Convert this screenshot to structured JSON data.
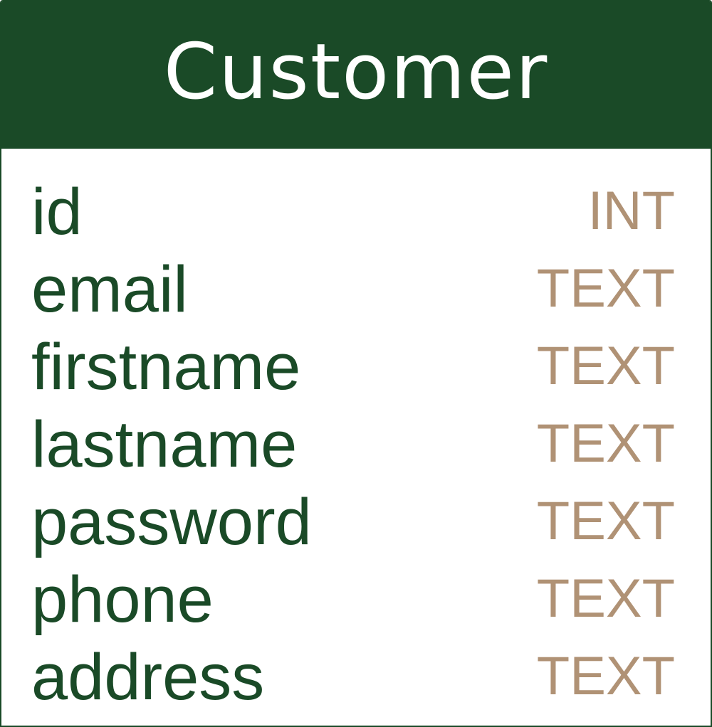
{
  "entity": {
    "title": "Customer",
    "header_color": "#1a4a27",
    "name_color": "#1a4a27",
    "type_color": "#b09275",
    "fields": [
      {
        "name": "id",
        "type": "INT"
      },
      {
        "name": "email",
        "type": "TEXT"
      },
      {
        "name": "firstname",
        "type": "TEXT"
      },
      {
        "name": "lastname",
        "type": "TEXT"
      },
      {
        "name": "password",
        "type": "TEXT"
      },
      {
        "name": "phone",
        "type": "TEXT"
      },
      {
        "name": "address",
        "type": "TEXT"
      }
    ]
  }
}
